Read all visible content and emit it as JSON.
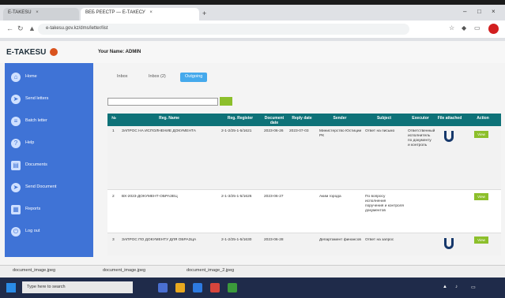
{
  "browser": {
    "tabs": [
      {
        "label": "E-TAKESU"
      },
      {
        "label": "ВЕБ РЕЕСТР — Е-ТАКЕСУ"
      }
    ],
    "address": "e-takesu.gov.kz/dms/letter/list"
  },
  "app": {
    "logo_text": "E-TAKESU",
    "welcome": "Your Name: ADMIN"
  },
  "sidebar": {
    "items": [
      {
        "label": "Home",
        "icon": "home-icon"
      },
      {
        "label": "Send letters",
        "icon": "send-icon"
      },
      {
        "label": "Batch letter",
        "icon": "batch-icon"
      },
      {
        "label": "Help",
        "icon": "help-icon"
      },
      {
        "label": "Documents",
        "icon": "document-icon"
      },
      {
        "label": "Send Document",
        "icon": "send-doc-icon"
      },
      {
        "label": "Reports",
        "icon": "report-icon"
      },
      {
        "label": "Log out",
        "icon": "logout-icon"
      }
    ]
  },
  "subtabs": [
    {
      "label": "Inbox"
    },
    {
      "label": "Inbox (2)"
    },
    {
      "label": "Outgoing"
    }
  ],
  "search": {
    "placeholder": ""
  },
  "table": {
    "headers": [
      "№",
      "Reg. Name",
      "Reg. Register",
      "Document date",
      "Reply date",
      "Sender",
      "Subject",
      "Executor",
      "File attached",
      "Action"
    ],
    "rows": [
      {
        "num": "1",
        "name": "ЗАПРОС НА ИСПОЛНЕНИЕ ДОКУМЕНТА",
        "reg": "2-1-2/25-1-5/1621",
        "doc_date": "2023-06-26",
        "reply_date": "2023-07-03",
        "sender": "Министерство Юстиции РК",
        "subject": "Ответ на письмо",
        "executor": "Ответственный исполнитель по документу и контроль",
        "has_file": true,
        "action": "View"
      },
      {
        "num": "2",
        "name": "ВХ-2023-ДОКУМЕНТ-ОБРАЗЕЦ",
        "reg": "2-1-3/25-1-5/1626",
        "doc_date": "2023-06-27",
        "reply_date": "",
        "sender": "Аким города",
        "subject": "По вопросу исполнения поручения и контроля документов",
        "executor": "",
        "has_file": false,
        "action": "View"
      },
      {
        "num": "3",
        "name": "ЗАПРОС ПО ДОКУМЕНТУ ДЛЯ ОБРАЗЦА",
        "reg": "2-1-2/25-1-5/1630",
        "doc_date": "2023-06-28",
        "reply_date": "",
        "sender": "Департамент финансов",
        "subject": "Ответ на запрос",
        "executor": "",
        "has_file": true,
        "action": "View"
      }
    ]
  },
  "downloads": [
    {
      "label": "document_image.jpeg"
    },
    {
      "label": "document_image.jpeg"
    },
    {
      "label": "document_image_2.jpeg"
    }
  ],
  "taskbar": {
    "search_placeholder": "Type here to search"
  }
}
